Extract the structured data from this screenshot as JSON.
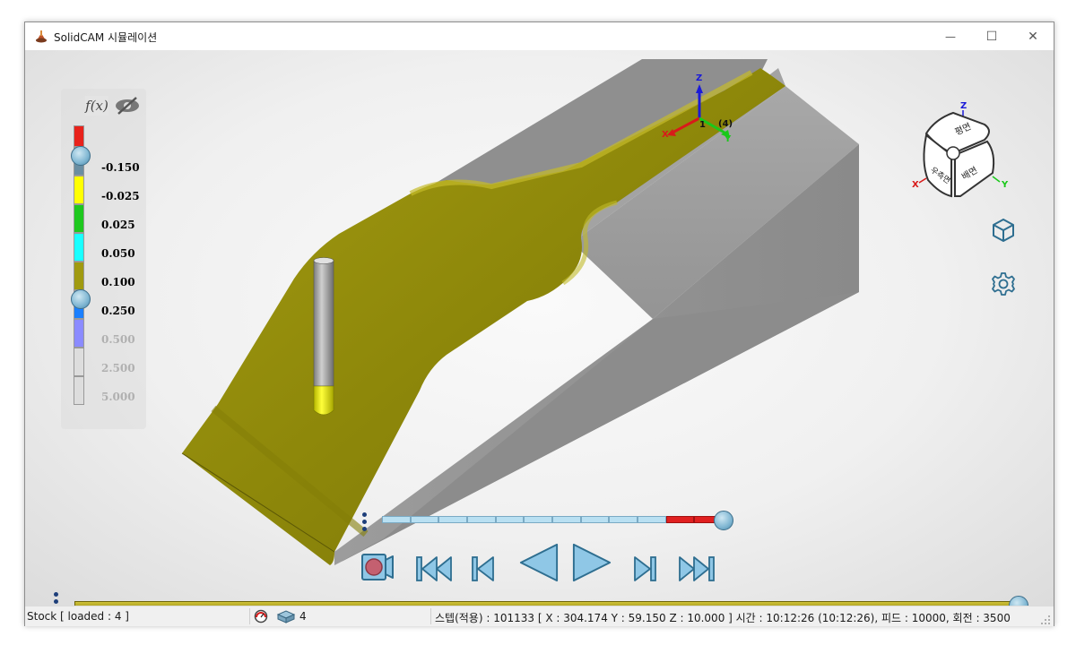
{
  "window": {
    "title": "SolidCAM 시뮬레이션",
    "minimize_symbol": "—",
    "maximize_symbol": "☐",
    "close_symbol": "✕"
  },
  "legend": {
    "fx_label": "f(x)",
    "hide_icon": "eye-slash-icon",
    "levels": [
      {
        "label": "",
        "color": "#e8221b"
      },
      {
        "label": "-0.150",
        "color": "#6a8ea2",
        "active": true
      },
      {
        "label": "-0.025",
        "color": "#ffff00",
        "active": true
      },
      {
        "label": "0.025",
        "color": "#1ec81e",
        "active": true
      },
      {
        "label": "0.050",
        "color": "#19ffff",
        "active": true
      },
      {
        "label": "0.100",
        "color": "#a09a10",
        "active": true
      },
      {
        "label": "0.250",
        "color": "#1a7fff",
        "active": true
      },
      {
        "label": "0.500",
        "color": "#8b8bff",
        "active": false
      },
      {
        "label": "2.500",
        "color": "#dddddd",
        "active": false
      },
      {
        "label": "5.000",
        "color": "#dddddd",
        "active": false
      }
    ],
    "active_text_color": "#000000",
    "inactive_text_color": "#b0b0b0"
  },
  "scene": {
    "axis_x": "X",
    "axis_y": "Y",
    "axis_z": "Z",
    "origin_label_1": "1",
    "origin_label_4": "(4)",
    "stock_color": "#9c9410",
    "block_color": "#9a9a9a"
  },
  "viewcube": {
    "top_face": "평면",
    "front_face": "정면",
    "right_face": "배면",
    "left_face": "우측면",
    "axis_x": "X",
    "axis_y": "Y",
    "axis_z": "Z",
    "view_icon": "cube-view-icon",
    "settings_icon": "gear-icon"
  },
  "playback": {
    "position_fraction": 1.0,
    "buttons": [
      "record-icon",
      "skip-to-start-icon",
      "step-back-icon",
      "play-reverse-icon",
      "play-icon",
      "step-forward-icon",
      "skip-to-end-icon"
    ]
  },
  "main_slider": {
    "position_fraction": 1.0
  },
  "status": {
    "stock": "Stock [ loaded : 4 ]",
    "tool_count": "4",
    "info": "스텝(적용) : 101133 [ X : 304.174 Y : 59.150 Z : 10.000 ]  시간 : 10:12:26 (10:12:26), 피드 : 10000, 회전 : 3500"
  }
}
